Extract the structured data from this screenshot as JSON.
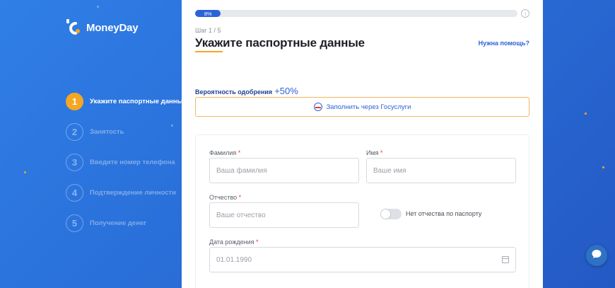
{
  "brand": {
    "name": "MoneyDay",
    "accent": "#f5a623",
    "primary": "#2c62d9"
  },
  "steps": [
    {
      "num": "1",
      "label": "Укажите паспортные данные",
      "active": true
    },
    {
      "num": "2",
      "label": "Занятость",
      "active": false
    },
    {
      "num": "3",
      "label": "Введите номер телефона",
      "active": false
    },
    {
      "num": "4",
      "label": "Подтверждение личности",
      "active": false
    },
    {
      "num": "5",
      "label": "Получение денег",
      "active": false
    }
  ],
  "progress": {
    "value": 0.08,
    "label": "8%"
  },
  "header": {
    "step_counter": "Шаг 1 / 5",
    "title": "Укажите паспортные данные",
    "help_link": "Нужна помощь?"
  },
  "approval": {
    "label": "Вероятность одобрения",
    "value": "+50%"
  },
  "gosuslugi_button": {
    "label": "Заполнить через Госуслуги"
  },
  "form": {
    "surname": {
      "label": "Фамилия",
      "required": "*",
      "placeholder": "Ваша фамилия"
    },
    "name": {
      "label": "Имя",
      "required": "*",
      "placeholder": "Ваше имя"
    },
    "patronymic": {
      "label": "Отчество",
      "required": "*",
      "placeholder": "Ваше отчество"
    },
    "no_patronymic": {
      "label": "Нет отчества по паспорту",
      "checked": false
    },
    "birthdate": {
      "label": "Дата рождения",
      "required": "*",
      "placeholder": "01.01.1990"
    }
  },
  "icons": {
    "info": "info-icon",
    "gosuslugi": "gosuslugi-icon",
    "calendar": "calendar-icon",
    "chat": "chat-icon",
    "logo": "moneyday-logo-icon"
  }
}
